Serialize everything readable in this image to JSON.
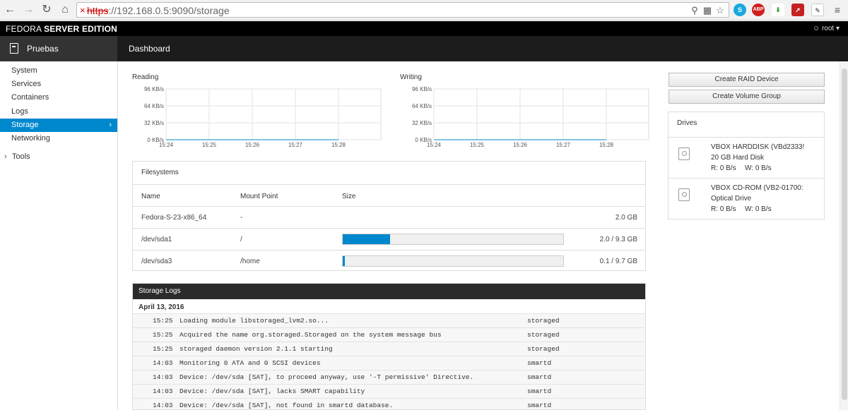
{
  "browser": {
    "url_scheme": "https",
    "url_rest": "://192.168.0.5:9090/storage",
    "icons": [
      "back-arrow-icon",
      "forward-arrow-icon",
      "reload-icon",
      "home-icon",
      "insecure-x-icon",
      "zoom-icon",
      "translate-icon",
      "star-icon",
      "skype-icon",
      "adblock-icon",
      "download-icon",
      "pdf-icon",
      "notes-icon",
      "menu-icon"
    ],
    "adblock_label": "ABP"
  },
  "masthead": {
    "brand_light": "FEDORA ",
    "brand_bold": "SERVER EDITION",
    "user": "root"
  },
  "sidebar": {
    "server_name": "Pruebas",
    "items": [
      "System",
      "Services",
      "Containers",
      "Logs",
      "Storage",
      "Networking"
    ],
    "active": "Storage",
    "tools": "Tools"
  },
  "breadcrumb": "Dashboard",
  "charts": {
    "reading": {
      "label": "Reading",
      "y_ticks": [
        "96 KB/s",
        "64 KB/s",
        "32 KB/s",
        "0 KB/s"
      ],
      "x_ticks": [
        "15:24",
        "15:25",
        "15:26",
        "15:27",
        "15:28"
      ],
      "values": [
        0,
        0,
        0,
        0,
        0
      ]
    },
    "writing": {
      "label": "Writing",
      "y_ticks": [
        "96 KB/s",
        "64 KB/s",
        "32 KB/s",
        "0 KB/s"
      ],
      "x_ticks": [
        "15:24",
        "15:25",
        "15:26",
        "15:27",
        "15:28"
      ],
      "values": [
        0,
        0,
        0,
        0,
        0
      ]
    }
  },
  "filesystems": {
    "title": "Filesystems",
    "headers": [
      "Name",
      "Mount Point",
      "Size"
    ],
    "rows": [
      {
        "name": "Fedora-S-23-x86_64",
        "mount": "-",
        "size": "2.0 GB",
        "usage": null
      },
      {
        "name": "/dev/sda1",
        "mount": "/",
        "size": "2.0 / 9.3 GB",
        "usage": 0.215
      },
      {
        "name": "/dev/sda3",
        "mount": "/home",
        "size": "0.1 / 9.7 GB",
        "usage": 0.01
      }
    ]
  },
  "logs": {
    "title": "Storage Logs",
    "date": "April 13, 2016",
    "rows": [
      {
        "time": "15:25",
        "msg": "Loading module libstoraged_lvm2.so...",
        "src": "storaged"
      },
      {
        "time": "15:25",
        "msg": "Acquired the name org.storaged.Storaged on the system message bus",
        "src": "storaged"
      },
      {
        "time": "15:25",
        "msg": "storaged daemon version 2.1.1 starting",
        "src": "storaged"
      },
      {
        "time": "14:03",
        "msg": "Monitoring 0 ATA and 0 SCSI devices",
        "src": "smartd"
      },
      {
        "time": "14:03",
        "msg": "Device: /dev/sda [SAT], to proceed anyway, use '-T permissive' Directive.",
        "src": "smartd"
      },
      {
        "time": "14:03",
        "msg": "Device: /dev/sda [SAT], lacks SMART capability",
        "src": "smartd"
      },
      {
        "time": "14:03",
        "msg": "Device: /dev/sda [SAT], not found in smartd database.",
        "src": "smartd"
      }
    ]
  },
  "actions": {
    "raid": "Create RAID Device",
    "volume_group": "Create Volume Group"
  },
  "drives": {
    "title": "Drives",
    "items": [
      {
        "name": "VBOX HARDDISK (VBd2333!",
        "type": "20 GB Hard Disk",
        "rw": "R: 0 B/s",
        "w": "W: 0 B/s"
      },
      {
        "name": "VBOX CD-ROM (VB2-01700:",
        "type": "Optical Drive",
        "rw": "R: 0 B/s",
        "w": "W: 0 B/s"
      }
    ]
  },
  "colors": {
    "accent": "#0088ce",
    "masthead": "#000000",
    "nav": "#1c1c1c",
    "sidebar_head": "#333333"
  }
}
